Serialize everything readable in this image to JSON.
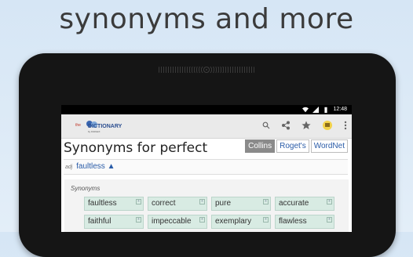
{
  "headline": "synonyms and more",
  "status_bar": {
    "time": "12:48"
  },
  "app": {
    "logo_small": "the",
    "logo_big": "DICTIONARY",
    "logo_sub": "by FARLEX",
    "icons": [
      "search-icon",
      "share-icon",
      "star-icon",
      "daily-icon",
      "overflow-menu-icon"
    ]
  },
  "page": {
    "title": "Synonyms for perfect",
    "tabs": [
      "Collins",
      "Roget's",
      "WordNet"
    ],
    "active_tab": "Collins",
    "headword": {
      "pos": "adj",
      "word": "faultless ▲"
    }
  },
  "synonyms": {
    "label": "Synonyms",
    "items": [
      "faultless",
      "correct",
      "pure",
      "accurate",
      "faithful",
      "impeccable",
      "exemplary",
      "flawless"
    ]
  },
  "colors": {
    "chip_bg": "#d8ebe3",
    "link": "#2a5ca8",
    "active_tab": "#8a8a8a"
  }
}
